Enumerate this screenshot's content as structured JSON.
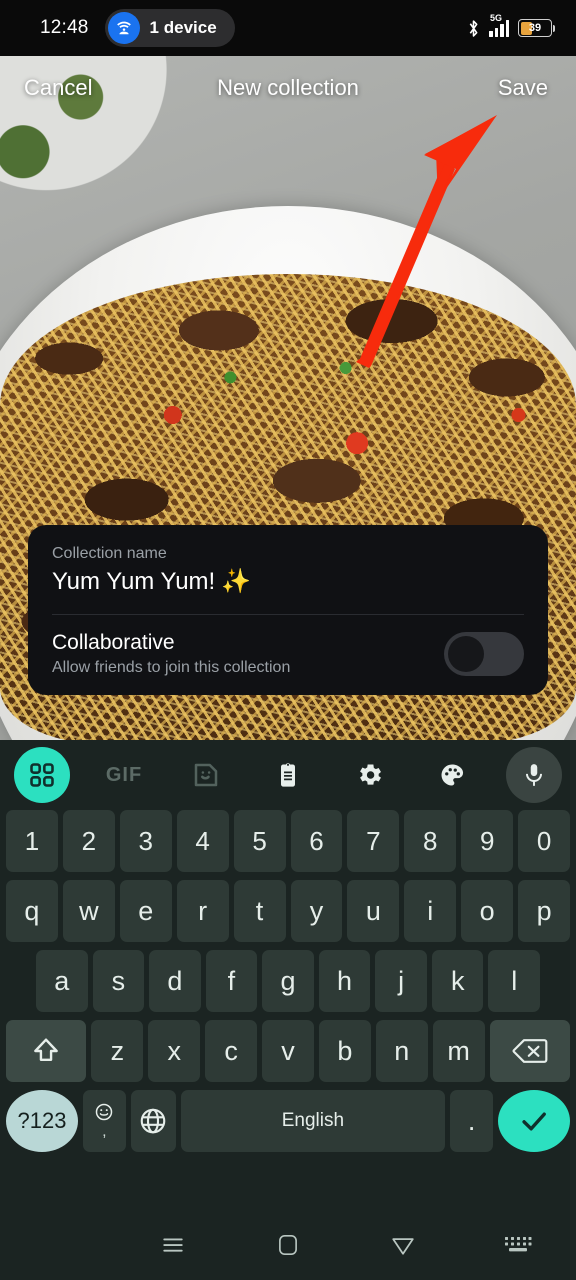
{
  "status_bar": {
    "time": "12:48",
    "cast_pill_label": "1 device",
    "cast_icon": "cast-wifi-icon",
    "bluetooth_icon": "bluetooth-icon",
    "network_type": "5G",
    "signal_icon": "signal-bars-icon",
    "battery_percent": "39",
    "battery_level": 39,
    "battery_color": "#e8a33d"
  },
  "top_bar": {
    "cancel_label": "Cancel",
    "title": "New collection",
    "save_label": "Save"
  },
  "annotation": {
    "arrow_color": "#f72b0c",
    "arrow_points_to": "Save"
  },
  "dialog": {
    "name_label": "Collection name",
    "name_value": "Yum Yum Yum!",
    "name_emoji": "✨",
    "collaborative_title": "Collaborative",
    "collaborative_subtitle": "Allow friends to join this collection",
    "collaborative_enabled": false,
    "card_bg": "#101114"
  },
  "keyboard": {
    "accent_color": "#2ce0c0",
    "toolbar": [
      {
        "name": "grid-apps-icon",
        "label": ""
      },
      {
        "name": "gif-icon",
        "label": "GIF"
      },
      {
        "name": "sticker-icon",
        "label": ""
      },
      {
        "name": "clipboard-icon",
        "label": ""
      },
      {
        "name": "gear-icon",
        "label": ""
      },
      {
        "name": "palette-icon",
        "label": ""
      },
      {
        "name": "microphone-icon",
        "label": ""
      }
    ],
    "row_numbers": [
      "1",
      "2",
      "3",
      "4",
      "5",
      "6",
      "7",
      "8",
      "9",
      "0"
    ],
    "row_top": [
      "q",
      "w",
      "e",
      "r",
      "t",
      "y",
      "u",
      "i",
      "o",
      "p"
    ],
    "row_home": [
      "a",
      "s",
      "d",
      "f",
      "g",
      "h",
      "j",
      "k",
      "l"
    ],
    "row_bottom": [
      "z",
      "x",
      "c",
      "v",
      "b",
      "n",
      "m"
    ],
    "shift_icon": "shift-arrow-icon",
    "backspace_icon": "backspace-icon",
    "symbols_label": "?123",
    "emoji_icon": "emoji-icon",
    "comma_label": ",",
    "globe_icon": "globe-language-icon",
    "space_label": "English",
    "period_label": ".",
    "enter_icon": "checkmark-icon"
  },
  "nav_bar": {
    "recents_icon": "recents-menu-icon",
    "home_icon": "home-square-icon",
    "back_icon": "back-triangle-icon",
    "hide_keyboard_icon": "hide-keyboard-icon"
  }
}
